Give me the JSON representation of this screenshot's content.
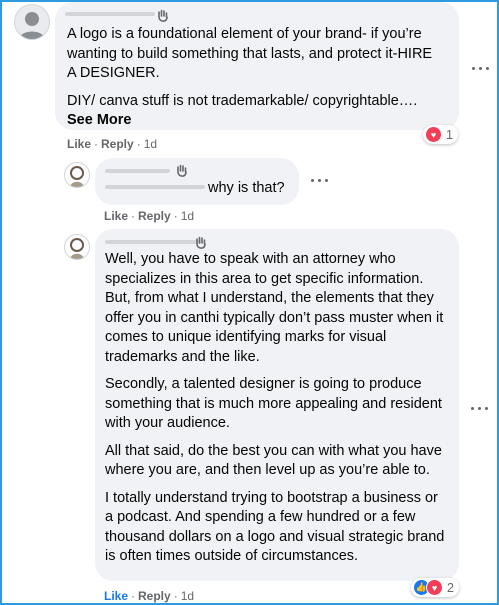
{
  "comments": [
    {
      "text": [
        "A logo is a foundational element of your brand- if you’re wanting to build something that lasts, and protect it-HIRE A DESIGNER.",
        "DIY/ canva stuff is not trademarkable/ copyrightable…."
      ],
      "see_more": "See More",
      "actions": {
        "like": "Like",
        "reply": "Reply",
        "time": "1d"
      },
      "reactions": {
        "count": "1",
        "types": [
          "love"
        ]
      }
    },
    {
      "text": [
        "why is that?"
      ],
      "actions": {
        "like": "Like",
        "reply": "Reply",
        "time": "1d"
      }
    },
    {
      "text": [
        "Well, you have to speak with an attorney who specializes in this area to get specific information. But, from what I understand, the elements that they offer you in canthi typically don’t pass muster when it comes to unique identifying marks for visual trademarks and the like.",
        "Secondly, a talented designer is going to produce something that is much more appealing and resident with your audience.",
        "All that said, do the best you can with what you have where you are, and then level up as you’re able to.",
        "I totally understand trying to bootstrap a business or a podcast. And spending a few hundred or a few thousand dollars on a logo and visual strategic brand is often times outside of circumstances."
      ],
      "actions": {
        "like": "Like",
        "reply": "Reply",
        "time": "1d"
      },
      "reactions": {
        "count": "2",
        "types": [
          "like",
          "love"
        ]
      }
    }
  ],
  "colors": {
    "bubble": "#f0f2f5",
    "meta": "#65676b",
    "link_blue": "#1877f2",
    "love_red": "#f33e58",
    "frame": "#2f9ae0"
  },
  "icons": [
    "wave-icon",
    "more-options-icon",
    "love-reaction-icon",
    "like-reaction-icon"
  ]
}
